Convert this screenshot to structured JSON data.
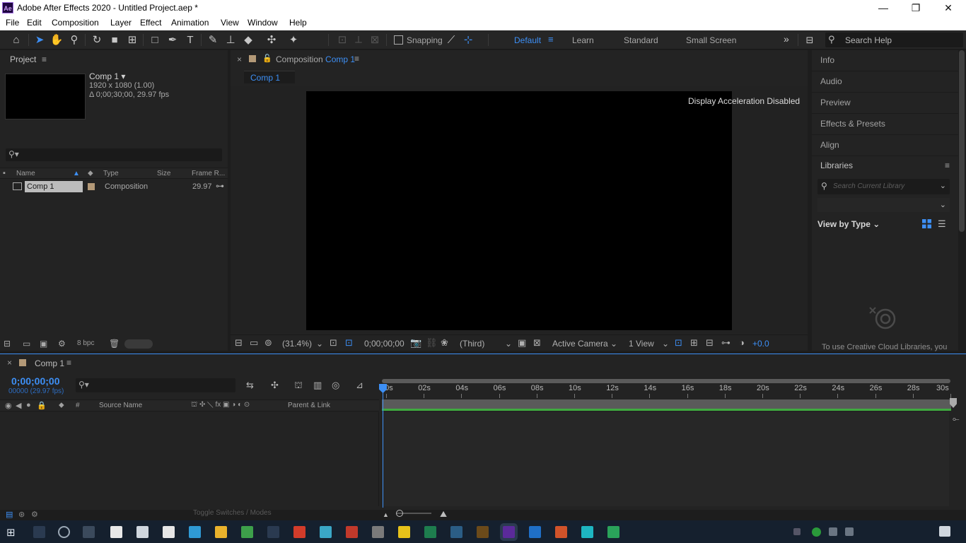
{
  "titlebar": {
    "logo": "Ae",
    "title": "Adobe After Effects 2020 - Untitled Project.aep *",
    "minimize": "—",
    "maximize": "❐",
    "close": "✕"
  },
  "menu": [
    "File",
    "Edit",
    "Composition",
    "Layer",
    "Effect",
    "Animation",
    "View",
    "Window",
    "Help"
  ],
  "toolbar": {
    "snapping_label": "Snapping",
    "workspaces": [
      "Default",
      "Learn",
      "Standard",
      "Small Screen"
    ],
    "active_workspace": "Default",
    "more": "»",
    "search_help": "Search Help"
  },
  "project": {
    "title": "Project",
    "comp_name": "Comp 1 ▾",
    "comp_res": "1920 x 1080 (1.00)",
    "comp_dur": "Δ 0;00;30;00, 29.97 fps",
    "columns": {
      "name": "Name",
      "type": "Type",
      "size": "Size",
      "frame_rate": "Frame R..."
    },
    "items": [
      {
        "name": "Comp 1",
        "type": "Composition",
        "frame_rate": "29.97"
      }
    ],
    "bpc": "8 bpc"
  },
  "composition": {
    "tab_prefix": "Composition",
    "tab_name": "Comp 1",
    "subtab": "Comp 1",
    "overlay": "Display Acceleration Disabled",
    "zoom": "(31.4%)",
    "timecode": "0;00;00;00",
    "resolution": "(Third)",
    "camera": "Active Camera",
    "views": "1 View",
    "exposure": "+0.0"
  },
  "right_panels": {
    "items": [
      "Info",
      "Audio",
      "Preview",
      "Effects & Presets",
      "Align"
    ],
    "libraries_title": "Libraries",
    "search_placeholder": "Search Current Library",
    "view_by": "View by Type",
    "cc_message": "To use Creative Cloud Libraries, you"
  },
  "timeline": {
    "tab_name": "Comp 1",
    "current_time": "0;00;00;00",
    "fps_line": "00000 (29.97 fps)",
    "columns": {
      "hash": "#",
      "source_name": "Source Name",
      "parent_link": "Parent & Link"
    },
    "ruler_ticks": [
      "00s",
      "02s",
      "04s",
      "06s",
      "08s",
      "10s",
      "12s",
      "14s",
      "16s",
      "18s",
      "20s",
      "22s",
      "24s",
      "26s",
      "28s",
      "30s"
    ],
    "toggle_label": "Toggle Switches / Modes"
  }
}
